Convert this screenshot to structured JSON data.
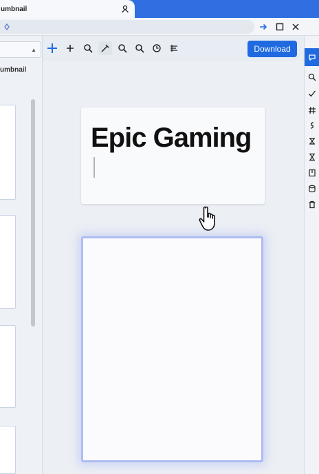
{
  "tab": {
    "title": "umbnail"
  },
  "left_panel": {
    "label": "umbnail"
  },
  "toolbar": {
    "download_label": "Download"
  },
  "canvas": {
    "card_title": "Epic Gaming"
  },
  "colors": {
    "accent": "#1f6ae0",
    "tab_strip": "#2f6fe0",
    "frame_border": "#aebcf0"
  },
  "icons": {
    "toolbar": [
      "plus-large-icon",
      "plus-icon",
      "zoom-icon",
      "eyedropper-icon",
      "zoom-in-icon",
      "zoom-out-icon",
      "history-icon",
      "layers-icon"
    ],
    "sidebar": [
      "chat-icon",
      "search-icon",
      "check-icon",
      "hash-icon",
      "snake-icon",
      "transform-icon",
      "hourglass-icon",
      "book-icon",
      "database-icon",
      "trash-icon"
    ]
  }
}
